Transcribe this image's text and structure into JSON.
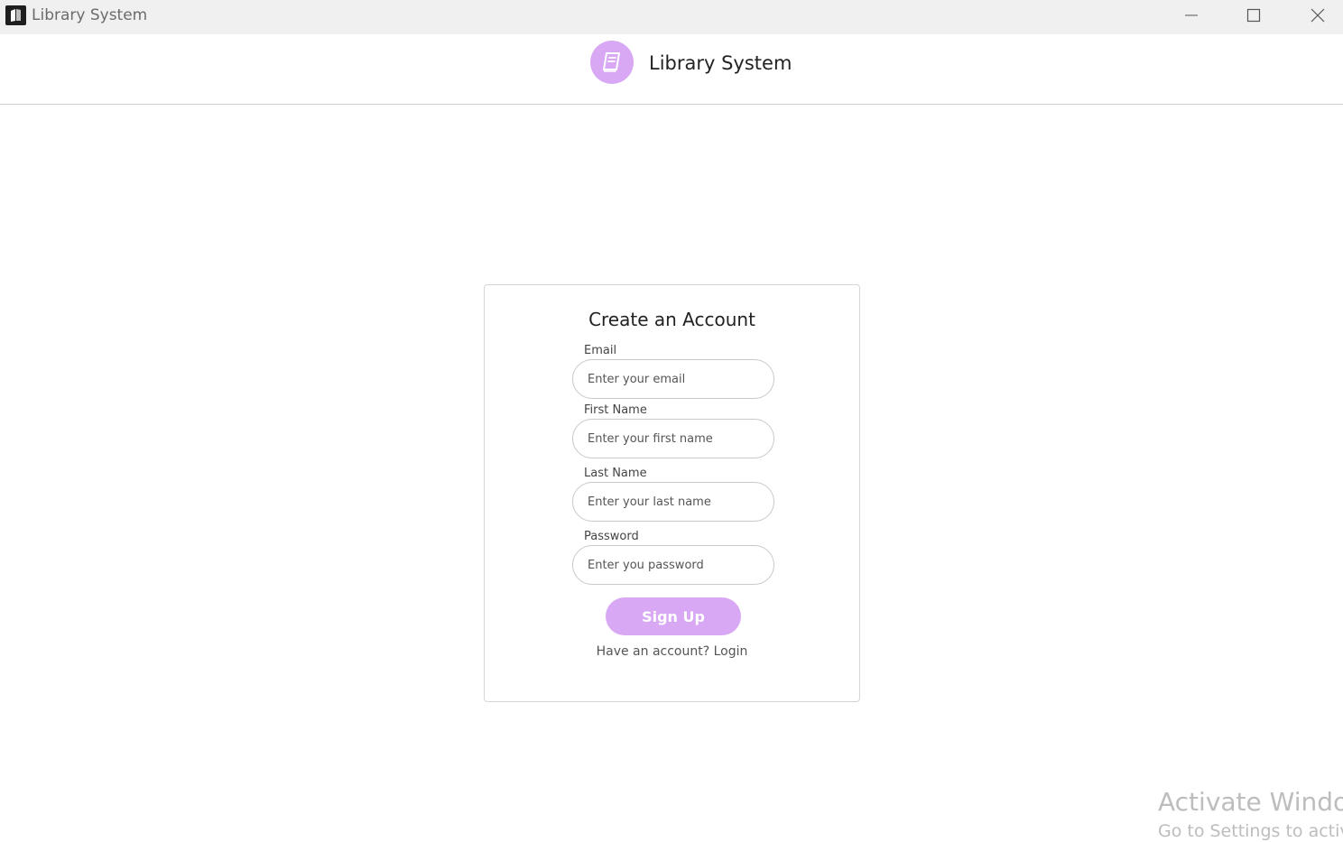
{
  "window": {
    "title": "Library System",
    "controls": [
      "minimize",
      "maximize",
      "close"
    ]
  },
  "header": {
    "title": "Library System",
    "logo_icon": "book-icon",
    "accent_color": "#d8a8f4"
  },
  "form": {
    "title": "Create an Account",
    "fields": [
      {
        "label": "Email",
        "placeholder": "Enter your email",
        "value": ""
      },
      {
        "label": "First Name",
        "placeholder": "Enter your first name",
        "value": ""
      },
      {
        "label": "Last Name",
        "placeholder": "Enter your last name",
        "value": ""
      },
      {
        "label": "Password",
        "placeholder": "Enter you password",
        "value": ""
      }
    ],
    "submit_label": "Sign Up",
    "login_prompt": "Have an account?",
    "login_link": "Login"
  },
  "watermark": {
    "line1": "Activate Windows",
    "line2": "Go to Settings to activate Windows."
  }
}
